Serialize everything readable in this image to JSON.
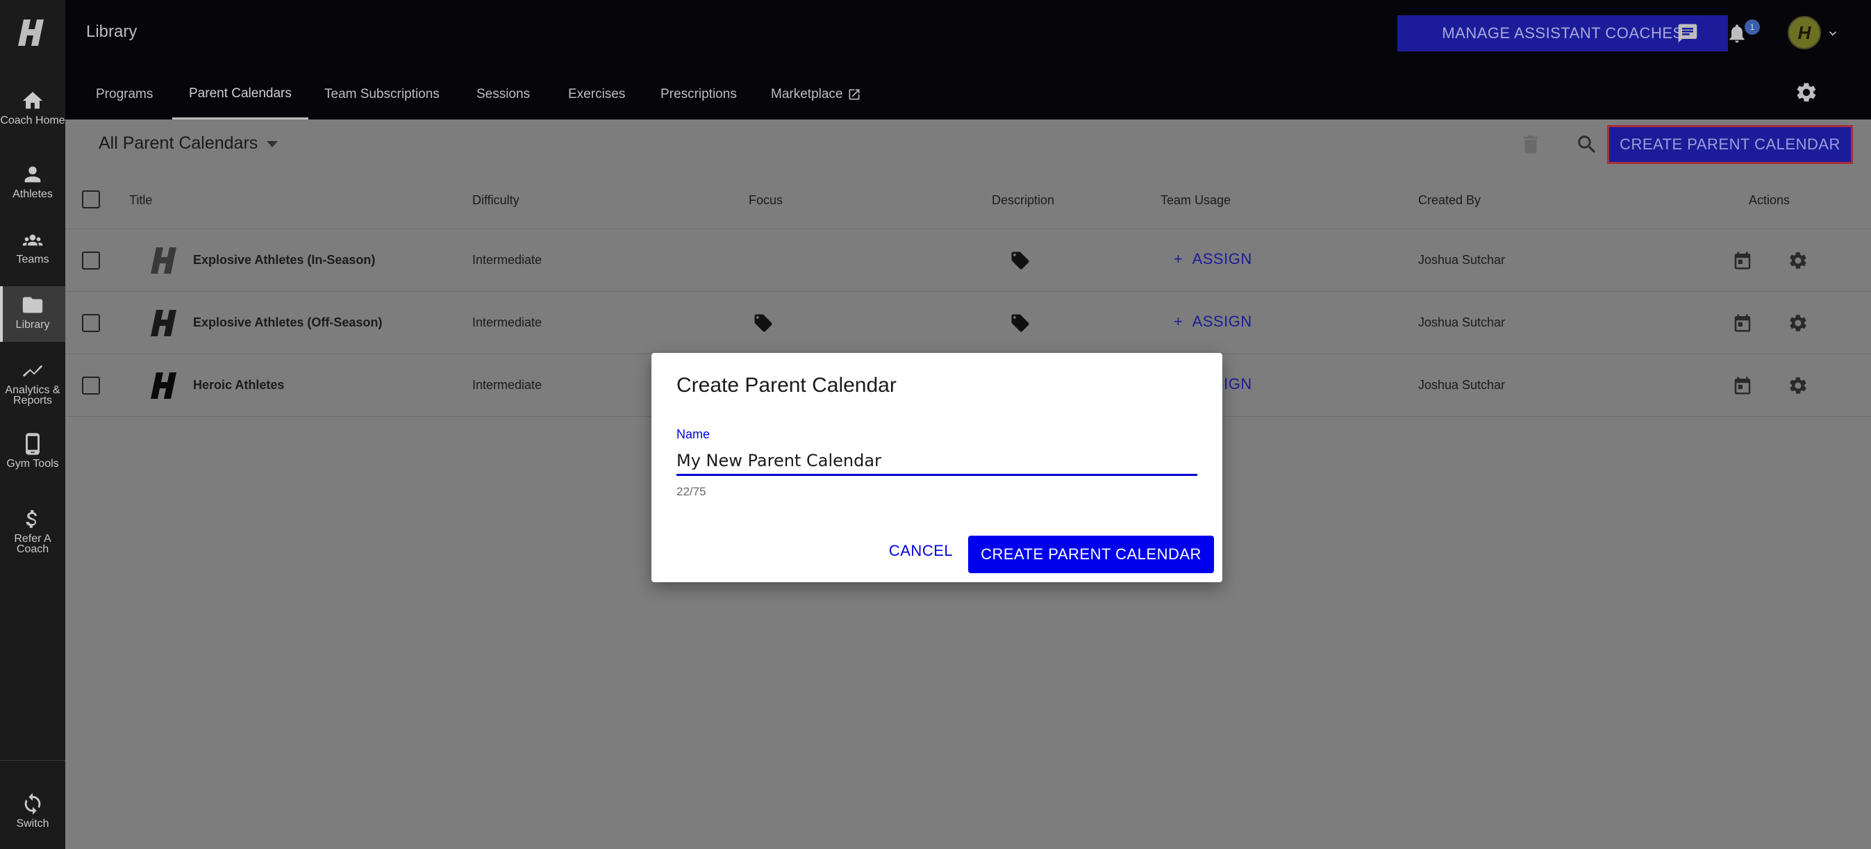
{
  "sidebar": {
    "items": [
      {
        "label": "Coach Home"
      },
      {
        "label": "Athletes"
      },
      {
        "label": "Teams"
      },
      {
        "label": "Library"
      },
      {
        "label": "Analytics & Reports"
      },
      {
        "label": "Gym Tools"
      },
      {
        "label": "Refer A Coach"
      }
    ],
    "switch_label": "Switch"
  },
  "header": {
    "title": "Library",
    "manage_button": "MANAGE ASSISTANT COACHES",
    "notification_count": "1",
    "avatar_letter": "H",
    "tabs": [
      {
        "label": "Programs"
      },
      {
        "label": "Parent Calendars"
      },
      {
        "label": "Team Subscriptions"
      },
      {
        "label": "Sessions"
      },
      {
        "label": "Exercises"
      },
      {
        "label": "Prescriptions"
      },
      {
        "label": "Marketplace"
      }
    ]
  },
  "toolbar": {
    "filter_label": "All Parent Calendars",
    "create_button": "CREATE PARENT CALENDAR"
  },
  "table": {
    "columns": [
      "Title",
      "Difficulty",
      "Focus",
      "Description",
      "Team Usage",
      "Created By",
      "Actions"
    ],
    "rows": [
      {
        "title": "Explosive Athletes (In-Season)",
        "difficulty": "Intermediate",
        "assign": "ASSIGN",
        "created_by": "Joshua Sutchar"
      },
      {
        "title": "Explosive Athletes (Off-Season)",
        "difficulty": "Intermediate",
        "assign": "ASSIGN",
        "created_by": "Joshua Sutchar"
      },
      {
        "title": "Heroic Athletes",
        "difficulty": "Intermediate",
        "assign": "ASSIGN",
        "created_by": "Joshua Sutchar"
      }
    ]
  },
  "dialog": {
    "title": "Create Parent Calendar",
    "name_label": "Name",
    "name_value": "My New Parent Calendar",
    "counter": "22/75",
    "cancel_label": "CANCEL",
    "create_label": "CREATE PARENT CALENDAR"
  },
  "colors": {
    "primary": "#0000ee",
    "overlay_primary": "#1c1c9a",
    "sidebar_bg": "#1b1b1b",
    "header_bg": "#06060a"
  }
}
